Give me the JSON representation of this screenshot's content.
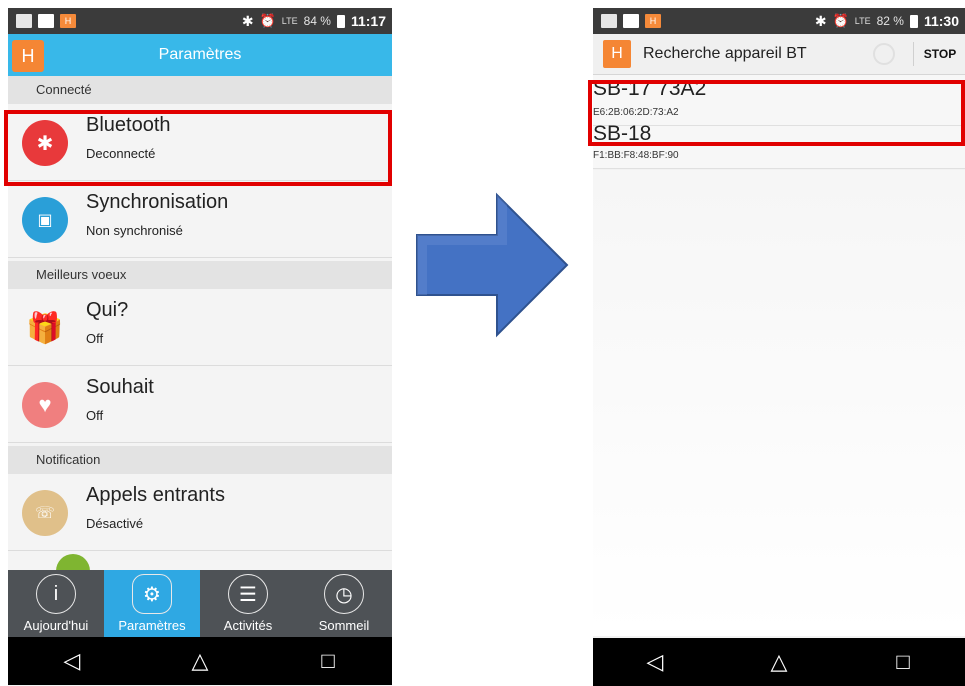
{
  "left": {
    "status": {
      "time": "11:17",
      "battery": "84 %",
      "signal": "LTE"
    },
    "header": {
      "logo": "H",
      "title": "Paramètres"
    },
    "sections": [
      {
        "label": "Connecté"
      },
      {
        "label": "Meilleurs voeux"
      },
      {
        "label": "Notification"
      }
    ],
    "rows": [
      {
        "title": "Bluetooth",
        "subtitle": "Deconnecté",
        "icon": "bluetooth-icon",
        "color": "#e8393b"
      },
      {
        "title": "Synchronisation",
        "subtitle": "Non synchronisé",
        "icon": "sync-icon",
        "color": "#2a9fd8"
      },
      {
        "title": "Qui?",
        "subtitle": "Off",
        "icon": "gift-hand-icon",
        "color": "#f48d8d"
      },
      {
        "title": "Souhait",
        "subtitle": "Off",
        "icon": "heart-icon",
        "color": "#f07f7f"
      },
      {
        "title": "Appels entrants",
        "subtitle": "Désactivé",
        "icon": "incoming-call-icon",
        "color": "#e0c08a"
      }
    ],
    "nav": [
      {
        "label": "Aujourd'hui",
        "icon": "info-icon",
        "active": false
      },
      {
        "label": "Paramètres",
        "icon": "gear-icon",
        "active": true
      },
      {
        "label": "Activités",
        "icon": "list-icon",
        "active": false
      },
      {
        "label": "Sommeil",
        "icon": "clock-icon",
        "active": false
      }
    ]
  },
  "right": {
    "status": {
      "time": "11:30",
      "battery": "82 %",
      "signal": "LTE"
    },
    "header": {
      "logo": "H",
      "title": "Recherche appareil BT",
      "stop": "STOP"
    },
    "devices": [
      {
        "name": "SB-17 73A2",
        "address": "E6:2B:06:2D:73:A2"
      },
      {
        "name": "SB-18",
        "address": "F1:BB:F8:48:BF:90"
      }
    ]
  },
  "colors": {
    "highlight": "#e10000",
    "arrow": "#4472c4",
    "header_blue": "#38b8e9",
    "brand_orange": "#f58634"
  }
}
